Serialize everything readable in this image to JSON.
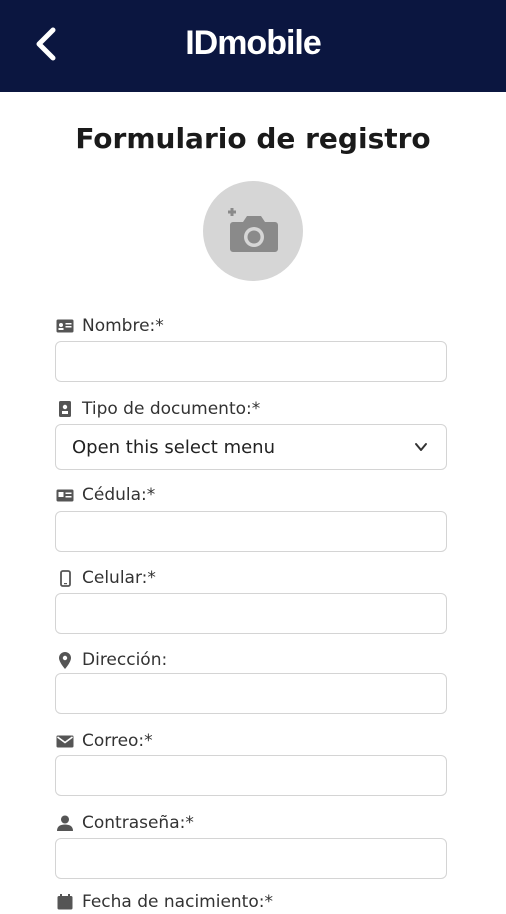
{
  "header": {
    "brand": "IDmobile",
    "back_icon": "back-arrow-icon",
    "background": "#0b1640"
  },
  "form": {
    "title": "Formulario de registro",
    "photo_icon": "add-photo-icon",
    "fields": {
      "nombre": {
        "label": "Nombre:*",
        "icon": "id-card-icon"
      },
      "tipo_documento": {
        "label": "Tipo de documento:*",
        "icon": "document-icon",
        "selected": "Open this select menu"
      },
      "cedula": {
        "label": "Cédula:*",
        "icon": "badge-icon"
      },
      "celular": {
        "label": "Celular:*",
        "icon": "phone-icon"
      },
      "direccion": {
        "label": "Dirección:",
        "icon": "location-icon"
      },
      "correo": {
        "label": "Correo:*",
        "icon": "mail-icon"
      },
      "contrasena": {
        "label": "Contraseña:*",
        "icon": "user-icon"
      },
      "next_partial": {
        "label": "Fecha de nacimiento:*",
        "icon": "calendar-icon"
      }
    }
  }
}
